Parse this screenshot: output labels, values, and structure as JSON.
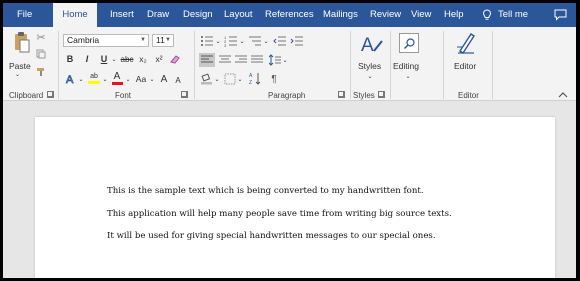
{
  "tabs": {
    "file": "File",
    "home": "Home",
    "insert": "Insert",
    "draw": "Draw",
    "design": "Design",
    "layout": "Layout",
    "references": "References",
    "mailings": "Mailings",
    "review": "Review",
    "view": "View",
    "help": "Help",
    "tell_me": "Tell me"
  },
  "ribbon": {
    "clipboard": {
      "label": "Clipboard",
      "paste_label": "Paste"
    },
    "font": {
      "label": "Font",
      "font_name": "Cambria",
      "font_size": "11",
      "bold": "B",
      "italic": "I",
      "underline": "U",
      "strike": "abc",
      "subscript": "x₂",
      "superscript": "x²",
      "change_case": "Aa",
      "grow": "A",
      "shrink": "A"
    },
    "paragraph": {
      "label": "Paragraph",
      "pilcrow": "¶"
    },
    "styles": {
      "label": "Styles",
      "button_label": "Styles"
    },
    "editing": {
      "button_label": "Editing"
    },
    "editor": {
      "label": "Editor",
      "button_label": "Editor"
    }
  },
  "document": {
    "lines": [
      "This is the sample text which is being converted to my handwritten font.",
      "This application will help many people save time from writing big source texts.",
      "It will be used for giving special handwritten messages to our special ones."
    ]
  },
  "colors": {
    "accent": "#2b579a",
    "highlight": "#ffff00",
    "font_color": "#e81123"
  },
  "icons": [
    "tellme-bulb-icon",
    "comment-icon",
    "paste-icon",
    "cut-icon",
    "copy-icon",
    "format-painter-icon",
    "clear-formatting-icon",
    "text-effects-icon",
    "highlight-icon",
    "font-color-icon",
    "bullets-icon",
    "numbering-icon",
    "multilevel-icon",
    "decrease-indent-icon",
    "increase-indent-icon",
    "align-left-icon",
    "center-icon",
    "align-right-icon",
    "justify-icon",
    "line-spacing-icon",
    "shading-icon",
    "borders-icon",
    "sort-icon",
    "styles-icon",
    "search-icon",
    "editor-icon",
    "chevron-up-icon"
  ]
}
